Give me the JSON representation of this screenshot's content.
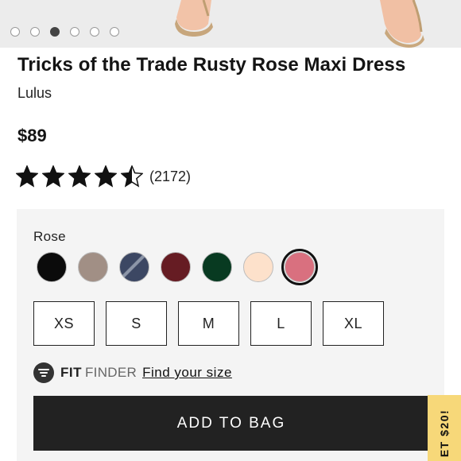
{
  "gallery": {
    "slides": [
      {
        "active": false
      },
      {
        "active": false
      },
      {
        "active": true
      },
      {
        "active": false
      },
      {
        "active": false
      },
      {
        "active": false
      }
    ]
  },
  "product": {
    "title": "Tricks of the Trade Rusty Rose Maxi Dress",
    "brand": "Lulus",
    "price": "$89",
    "rating": 4.5,
    "review_count": "(2172)"
  },
  "options": {
    "selected_color": "Rose",
    "colors": [
      {
        "name": "black",
        "hex": "#0b0b0b",
        "selected": false
      },
      {
        "name": "taupe",
        "hex": "#a18f85",
        "selected": false
      },
      {
        "name": "navy-stripe",
        "hex": "#3c4763",
        "selected": false
      },
      {
        "name": "burgundy",
        "hex": "#661c23",
        "selected": false
      },
      {
        "name": "emerald",
        "hex": "#083a21",
        "selected": false
      },
      {
        "name": "peach",
        "hex": "#fde1cb",
        "selected": false
      },
      {
        "name": "rose",
        "hex": "#d9707f",
        "selected": true
      }
    ],
    "sizes": [
      "XS",
      "S",
      "M",
      "L",
      "XL"
    ]
  },
  "fit_finder": {
    "brand_strong": "FIT",
    "brand_light": "FINDER",
    "link_label": "Find your size"
  },
  "cta": {
    "add_to_bag_label": "ADD TO BAG",
    "accent": "#222222"
  },
  "promo_tab": {
    "label": "ET $20!",
    "color": "#f7d879"
  }
}
